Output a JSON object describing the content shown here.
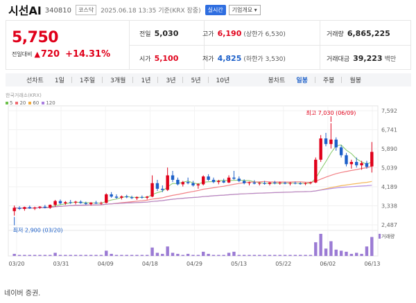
{
  "header": {
    "name": "시선AI",
    "code": "340810",
    "market_badge": "코스닥",
    "datetime": "2025.06.18 13:35  기준(KRX 장중)",
    "realtime_btn": "실시간",
    "company_btn": "기업개요 ▾"
  },
  "price": {
    "current": "5,750",
    "change_label": "전일대비",
    "change_amount": "720",
    "change_percent": "+14.31%"
  },
  "stats": {
    "prev_close_label": "전일",
    "prev_close": "5,030",
    "high_label": "고가",
    "high": "6,190",
    "upper_limit": "(상한가 6,530)",
    "volume_label": "거래량",
    "volume": "6,865,225",
    "open_label": "시가",
    "open": "5,100",
    "low_label": "저가",
    "low": "4,825",
    "lower_limit": "(하한가 3,530)",
    "value_label": "거래대금",
    "value": "39,223",
    "value_unit": "백만"
  },
  "periods": {
    "line_label": "선차트",
    "items": [
      "1일",
      "1주일",
      "3개월",
      "1년",
      "3년",
      "5년",
      "10년"
    ],
    "candle_label": "봉차트",
    "candle_items": [
      "일봉",
      "주봉",
      "월봉"
    ],
    "active_candle": 0
  },
  "chart_data": {
    "type": "candlestick",
    "legend_title": "한국거래소(KRX)",
    "ma_legend": [
      {
        "name": "5",
        "color": "#6cc04a"
      },
      {
        "name": "20",
        "color": "#f0696f"
      },
      {
        "name": "60",
        "color": "#f2a93b"
      },
      {
        "name": "120",
        "color": "#a97ee0"
      }
    ],
    "y_ticks": [
      "7,592",
      "6,741",
      "5,890",
      "5,039",
      "4,189",
      "3,338",
      "2,487"
    ],
    "ylim": [
      2487,
      7592
    ],
    "x_ticks": [
      "03/20",
      "03/31",
      "04/09",
      "04/18",
      "04/29",
      "05/13",
      "05/22",
      "06/02",
      "06/13"
    ],
    "high_annotation": "최고 7,030 (06/09)",
    "low_annotation": "최저 2,900 (03/20)",
    "volume_label": "거래량",
    "up_color": "#e0001a",
    "down_color": "#1d60c9",
    "candles": [
      [
        3100,
        3350,
        2900,
        3250
      ],
      [
        3250,
        3320,
        3150,
        3200
      ],
      [
        3200,
        3300,
        3120,
        3280
      ],
      [
        3280,
        3350,
        3200,
        3220
      ],
      [
        3220,
        3300,
        3150,
        3260
      ],
      [
        3260,
        3320,
        3200,
        3300
      ],
      [
        3300,
        3380,
        3220,
        3250
      ],
      [
        3250,
        3400,
        3200,
        3380
      ],
      [
        3380,
        3600,
        3300,
        3550
      ],
      [
        3550,
        3620,
        3400,
        3450
      ],
      [
        3450,
        3550,
        3380,
        3500
      ],
      [
        3500,
        3600,
        3420,
        3480
      ],
      [
        3480,
        3560,
        3400,
        3520
      ],
      [
        3520,
        3580,
        3430,
        3460
      ],
      [
        3460,
        3520,
        3380,
        3420
      ],
      [
        3420,
        3500,
        3350,
        3480
      ],
      [
        3480,
        3560,
        3420,
        3440
      ],
      [
        3440,
        3520,
        3380,
        3470
      ],
      [
        3470,
        3900,
        3450,
        3850
      ],
      [
        3850,
        3950,
        3700,
        3750
      ],
      [
        3750,
        3850,
        3650,
        3700
      ],
      [
        3700,
        3800,
        3620,
        3760
      ],
      [
        3760,
        3830,
        3680,
        3720
      ],
      [
        3720,
        3790,
        3640,
        3680
      ],
      [
        3680,
        3760,
        3600,
        3730
      ],
      [
        3730,
        3800,
        3660,
        3700
      ],
      [
        3700,
        3780,
        3620,
        3750
      ],
      [
        3750,
        4700,
        3720,
        4350
      ],
      [
        4350,
        4500,
        4000,
        4100
      ],
      [
        4100,
        4250,
        3950,
        4050
      ],
      [
        4050,
        5050,
        4000,
        4700
      ],
      [
        4700,
        4900,
        4400,
        4500
      ],
      [
        4500,
        4600,
        4250,
        4300
      ],
      [
        4300,
        4450,
        4200,
        4400
      ],
      [
        4400,
        4600,
        4300,
        4350
      ],
      [
        4350,
        4450,
        4200,
        4250
      ],
      [
        4250,
        4350,
        4100,
        4300
      ],
      [
        4300,
        4700,
        4250,
        4650
      ],
      [
        4650,
        4750,
        4450,
        4500
      ],
      [
        4500,
        4600,
        4350,
        4400
      ],
      [
        4400,
        4500,
        4300,
        4450
      ],
      [
        4450,
        4550,
        4350,
        4380
      ],
      [
        4380,
        4700,
        4350,
        4600
      ],
      [
        4600,
        4900,
        4500,
        4550
      ],
      [
        4550,
        4650,
        4400,
        4450
      ],
      [
        4450,
        4520,
        4300,
        4350
      ],
      [
        4350,
        4420,
        4250,
        4380
      ],
      [
        4380,
        4480,
        4300,
        4330
      ],
      [
        4330,
        4400,
        4250,
        4360
      ],
      [
        4360,
        4450,
        4280,
        4320
      ],
      [
        4320,
        4400,
        4250,
        4380
      ],
      [
        4380,
        4450,
        4300,
        4340
      ],
      [
        4340,
        4420,
        4280,
        4370
      ],
      [
        4370,
        4420,
        4300,
        4330
      ],
      [
        4330,
        4400,
        4250,
        4360
      ],
      [
        4360,
        4420,
        4300,
        4340
      ],
      [
        4340,
        4400,
        4280,
        4320
      ],
      [
        4320,
        4380,
        4260,
        4350
      ],
      [
        4350,
        4420,
        4300,
        4380
      ],
      [
        4380,
        5500,
        4350,
        5400
      ],
      [
        5400,
        6500,
        5300,
        6350
      ],
      [
        6350,
        6600,
        6000,
        6100
      ],
      [
        6100,
        7030,
        5900,
        6300
      ],
      [
        6300,
        6400,
        5800,
        5950
      ],
      [
        5950,
        6050,
        5500,
        5600
      ],
      [
        5600,
        5700,
        5100,
        5200
      ],
      [
        5200,
        5400,
        5000,
        5300
      ],
      [
        5300,
        5500,
        5050,
        5150
      ],
      [
        5150,
        5350,
        4950,
        5250
      ],
      [
        5250,
        5350,
        5000,
        5080
      ],
      [
        5100,
        6190,
        4825,
        5750
      ]
    ],
    "volumes": [
      2,
      1,
      1,
      1,
      1,
      1,
      1,
      1,
      3,
      1,
      1,
      1,
      1,
      1,
      1,
      1,
      1,
      1,
      5,
      2,
      1,
      1,
      1,
      1,
      1,
      1,
      1,
      8,
      3,
      2,
      9,
      3,
      2,
      1,
      2,
      1,
      1,
      4,
      2,
      1,
      1,
      1,
      3,
      4,
      1,
      1,
      1,
      1,
      1,
      1,
      1,
      1,
      1,
      1,
      1,
      1,
      1,
      1,
      1,
      13,
      21,
      7,
      14,
      6,
      5,
      4,
      2,
      3,
      2,
      9,
      18
    ]
  },
  "source_text": "네이버 증권."
}
